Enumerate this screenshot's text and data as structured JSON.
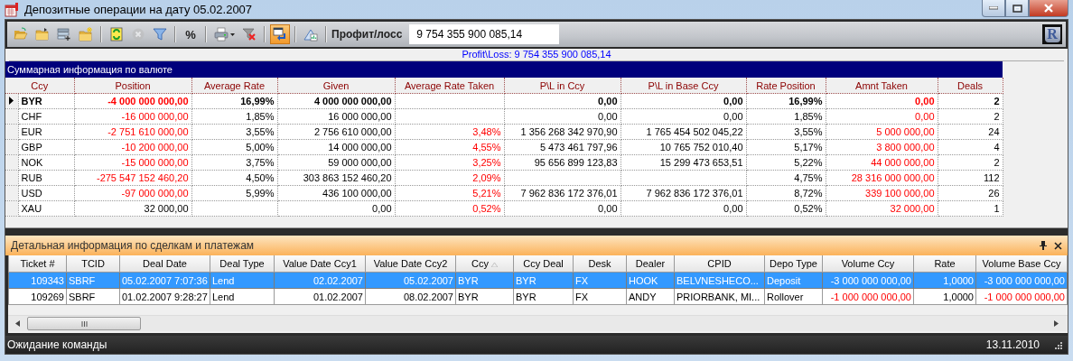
{
  "window": {
    "title": "Депозитные операции на дату 05.02.2007"
  },
  "toolbar": {
    "groups": [
      [
        {
          "kind": "icon",
          "pressed": false,
          "disabled": false
        },
        {
          "kind": "icon",
          "pressed": false,
          "disabled": false
        },
        {
          "kind": "icon",
          "pressed": false,
          "disabled": false
        },
        {
          "kind": "icon",
          "pressed": false,
          "disabled": false
        }
      ],
      [
        {
          "kind": "icon",
          "pressed": false,
          "disabled": false
        },
        {
          "kind": "icon",
          "pressed": false,
          "disabled": true
        },
        {
          "kind": "icon",
          "pressed": false,
          "disabled": false
        }
      ],
      [
        {
          "kind": "text",
          "label": "%",
          "pressed": false,
          "disabled": false
        }
      ],
      [
        {
          "kind": "dropdown",
          "pressed": false,
          "disabled": false
        },
        {
          "kind": "icon",
          "pressed": false,
          "disabled": false
        }
      ],
      [
        {
          "kind": "icon",
          "pressed": true,
          "disabled": false
        }
      ],
      [
        {
          "kind": "icon",
          "pressed": false,
          "disabled": false
        }
      ]
    ],
    "label": "Профит/лосс",
    "value": "9 754 355 900 085,14",
    "logo": "R"
  },
  "profit_line": "Profit\\Loss: 9 754 355 900 085,14",
  "summary": {
    "title": "Суммарная информация по валюте",
    "columns": [
      "Ccy",
      "Position",
      "Average Rate",
      "Given",
      "Average Rate Taken",
      "P\\L in Ccy",
      "P\\L in Base Ccy",
      "Rate Position",
      "Amnt Taken",
      "Deals"
    ],
    "rows": [
      {
        "current": true,
        "cells": [
          {
            "text": "BYR",
            "highlighted": false
          },
          {
            "text": "-4 000 000 000,00",
            "highlighted": true
          },
          {
            "text": "16,99%",
            "highlighted": false
          },
          {
            "text": "4 000 000 000,00",
            "highlighted": false
          },
          null,
          {
            "text": "0,00",
            "highlighted": false
          },
          {
            "text": "0,00",
            "highlighted": false
          },
          {
            "text": "16,99%",
            "highlighted": false
          },
          {
            "text": "0,00",
            "highlighted": true
          },
          {
            "text": "2",
            "highlighted": false
          }
        ]
      },
      {
        "current": false,
        "cells": [
          {
            "text": "CHF",
            "highlighted": false
          },
          {
            "text": "-16 000 000,00",
            "highlighted": true
          },
          {
            "text": "1,85%",
            "highlighted": false
          },
          {
            "text": "16 000 000,00",
            "highlighted": false
          },
          null,
          {
            "text": "0,00",
            "highlighted": false
          },
          {
            "text": "0,00",
            "highlighted": false
          },
          {
            "text": "1,85%",
            "highlighted": false
          },
          {
            "text": "0,00",
            "highlighted": true
          },
          {
            "text": "2",
            "highlighted": false
          }
        ]
      },
      {
        "current": false,
        "cells": [
          {
            "text": "EUR",
            "highlighted": false
          },
          {
            "text": "-2 751 610 000,00",
            "highlighted": true
          },
          {
            "text": "3,55%",
            "highlighted": false
          },
          {
            "text": "2 756 610 000,00",
            "highlighted": false
          },
          {
            "text": "3,48%",
            "highlighted": true
          },
          {
            "text": "1 356 268 342 970,90",
            "highlighted": false
          },
          {
            "text": "1 765 454 502 045,22",
            "highlighted": false
          },
          {
            "text": "3,55%",
            "highlighted": false
          },
          {
            "text": "5 000 000,00",
            "highlighted": true
          },
          {
            "text": "24",
            "highlighted": false
          }
        ]
      },
      {
        "current": false,
        "cells": [
          {
            "text": "GBP",
            "highlighted": false
          },
          {
            "text": "-10 200 000,00",
            "highlighted": true
          },
          {
            "text": "5,00%",
            "highlighted": false
          },
          {
            "text": "14 000 000,00",
            "highlighted": false
          },
          {
            "text": "4,55%",
            "highlighted": true
          },
          {
            "text": "5 473 461 797,96",
            "highlighted": false
          },
          {
            "text": "10 765 752 010,40",
            "highlighted": false
          },
          {
            "text": "5,17%",
            "highlighted": false
          },
          {
            "text": "3 800 000,00",
            "highlighted": true
          },
          {
            "text": "4",
            "highlighted": false
          }
        ]
      },
      {
        "current": false,
        "cells": [
          {
            "text": "NOK",
            "highlighted": false
          },
          {
            "text": "-15 000 000,00",
            "highlighted": true
          },
          {
            "text": "3,75%",
            "highlighted": false
          },
          {
            "text": "59 000 000,00",
            "highlighted": false
          },
          {
            "text": "3,25%",
            "highlighted": true
          },
          {
            "text": "95 656 899 123,83",
            "highlighted": false
          },
          {
            "text": "15 299 473 653,51",
            "highlighted": false
          },
          {
            "text": "5,22%",
            "highlighted": false
          },
          {
            "text": "44 000 000,00",
            "highlighted": true
          },
          {
            "text": "2",
            "highlighted": false
          }
        ]
      },
      {
        "current": false,
        "cells": [
          {
            "text": "RUB",
            "highlighted": false
          },
          {
            "text": "-275 547 152 460,20",
            "highlighted": true
          },
          {
            "text": "4,50%",
            "highlighted": false
          },
          {
            "text": "303 863 152 460,20",
            "highlighted": false
          },
          {
            "text": "2,09%",
            "highlighted": true
          },
          null,
          null,
          {
            "text": "4,75%",
            "highlighted": false
          },
          {
            "text": "28 316 000 000,00",
            "highlighted": true
          },
          {
            "text": "112",
            "highlighted": false
          }
        ]
      },
      {
        "current": false,
        "cells": [
          {
            "text": "USD",
            "highlighted": false
          },
          {
            "text": "-97 000 000,00",
            "highlighted": true
          },
          {
            "text": "5,99%",
            "highlighted": false
          },
          {
            "text": "436 100 000,00",
            "highlighted": false
          },
          {
            "text": "5,21%",
            "highlighted": true
          },
          {
            "text": "7 962 836 172 376,01",
            "highlighted": false
          },
          {
            "text": "7 962 836 172 376,01",
            "highlighted": false
          },
          {
            "text": "8,72%",
            "highlighted": false
          },
          {
            "text": "339 100 000,00",
            "highlighted": true
          },
          {
            "text": "26",
            "highlighted": false
          }
        ]
      },
      {
        "current": false,
        "cells": [
          {
            "text": "XAU",
            "highlighted": false
          },
          {
            "text": "32 000,00",
            "highlighted": false
          },
          null,
          {
            "text": "0,00",
            "highlighted": false
          },
          {
            "text": "0,52%",
            "highlighted": true
          },
          {
            "text": "0,00",
            "highlighted": false
          },
          {
            "text": "0,00",
            "highlighted": false
          },
          {
            "text": "0,52%",
            "highlighted": false
          },
          {
            "text": "32 000,00",
            "highlighted": true
          },
          {
            "text": "1",
            "highlighted": false
          }
        ]
      }
    ]
  },
  "details": {
    "title": "Детальная информация по сделкам и платежам",
    "columns": [
      {
        "label": "Ticket #",
        "sorted": false
      },
      {
        "label": "TCID",
        "sorted": false
      },
      {
        "label": "Deal Date",
        "sorted": false
      },
      {
        "label": "Deal Type",
        "sorted": false
      },
      {
        "label": "Value Date Ccy1",
        "sorted": false
      },
      {
        "label": "Value Date Ccy2",
        "sorted": false
      },
      {
        "label": "Ccy",
        "sorted": true
      },
      {
        "label": "Ccy Deal",
        "sorted": false
      },
      {
        "label": "Desk",
        "sorted": false
      },
      {
        "label": "Dealer",
        "sorted": false
      },
      {
        "label": "CPID",
        "sorted": false
      },
      {
        "label": "Depo Type",
        "sorted": false
      },
      {
        "label": "Volume Ccy",
        "sorted": false
      },
      {
        "label": "Rate",
        "sorted": false
      },
      {
        "label": "Volume Base Ccy",
        "sorted": false
      }
    ],
    "rows": [
      {
        "selected": true,
        "cells": [
          {
            "text": "109343",
            "highlighted": false
          },
          {
            "text": "SBRF",
            "highlighted": false
          },
          {
            "text": "05.02.2007 7:07:36",
            "highlighted": false
          },
          {
            "text": "Lend",
            "highlighted": false
          },
          {
            "text": "02.02.2007",
            "highlighted": false
          },
          {
            "text": "05.02.2007",
            "highlighted": false
          },
          {
            "text": "BYR",
            "highlighted": false
          },
          {
            "text": "BYR",
            "highlighted": false
          },
          {
            "text": "FX",
            "highlighted": false
          },
          {
            "text": "HOOK",
            "highlighted": false
          },
          {
            "text": "BELVNESHECO...",
            "highlighted": false
          },
          {
            "text": "Deposit",
            "highlighted": false
          },
          {
            "text": "-3 000 000 000,00",
            "highlighted": false
          },
          {
            "text": "1,0000",
            "highlighted": false
          },
          {
            "text": "-3 000 000 000,00",
            "highlighted": false
          }
        ]
      },
      {
        "selected": false,
        "cells": [
          {
            "text": "109269",
            "highlighted": false
          },
          {
            "text": "SBRF",
            "highlighted": false
          },
          {
            "text": "01.02.2007 9:28:27",
            "highlighted": false
          },
          {
            "text": "Lend",
            "highlighted": false
          },
          {
            "text": "01.02.2007",
            "highlighted": false
          },
          {
            "text": "08.02.2007",
            "highlighted": false
          },
          {
            "text": "BYR",
            "highlighted": false
          },
          {
            "text": "BYR",
            "highlighted": false
          },
          {
            "text": "FX",
            "highlighted": false
          },
          {
            "text": "ANDY",
            "highlighted": false
          },
          {
            "text": "PRIORBANK, MI...",
            "highlighted": false
          },
          {
            "text": "Rollover",
            "highlighted": false
          },
          {
            "text": "-1 000 000 000,00",
            "highlighted": true
          },
          {
            "text": "1,0000",
            "highlighted": false
          },
          {
            "text": "-1 000 000 000,00",
            "highlighted": true
          }
        ]
      }
    ]
  },
  "status_bar": {
    "message": "Ожидание команды",
    "date": "13.11.2010"
  }
}
